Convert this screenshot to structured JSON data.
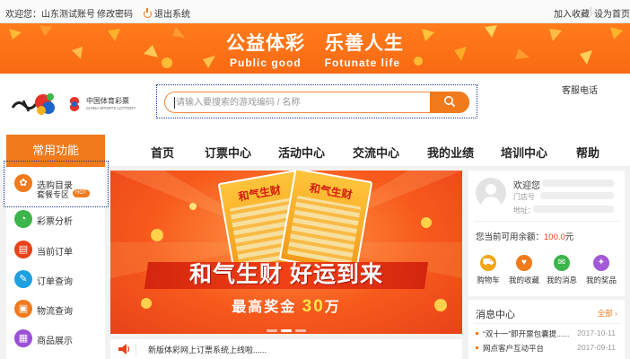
{
  "topbar": {
    "welcome": "欢迎您：山东测试账号",
    "change_password": "修改密码",
    "logout": "退出系统",
    "favorite": "加入收藏",
    "set_homepage": "设为首页"
  },
  "banner": {
    "title": "公益体彩　乐善人生",
    "subtitle": "Public good　　Fotunate life"
  },
  "header": {
    "lottery_name": "中国体育彩票",
    "lottery_name_en": "CHINA SPORTS LOTTERY",
    "search_placeholder": "请输入要搜索的游戏编码 / 名称",
    "hotline_label": "客服电话"
  },
  "nav": {
    "items": [
      "首页",
      "订票中心",
      "活动中心",
      "交流中心",
      "我的业绩",
      "培训中心",
      "帮助"
    ]
  },
  "sidebar": {
    "title": "常用功能",
    "items": [
      {
        "label": "选购目录",
        "icon": "catalog-icon",
        "color": "#f07a1c"
      },
      {
        "label": "彩票分析",
        "icon": "analysis-icon",
        "color": "#3cb54a"
      },
      {
        "label": "当前订单",
        "icon": "order-icon",
        "color": "#e8421a"
      },
      {
        "label": "订单查询",
        "icon": "order-search-icon",
        "color": "#1ea0e0"
      },
      {
        "label": "物流查询",
        "icon": "logistics-icon",
        "color": "#f07a1c"
      },
      {
        "label": "商品展示",
        "icon": "product-icon",
        "color": "#9b4fd6"
      }
    ],
    "sub_item": "套餐专区",
    "hot_badge": "HOT"
  },
  "promo": {
    "card_title": "和气生财",
    "headline": "和气生财 好运到来",
    "prize_prefix": "最高奖金",
    "prize_amount": "30",
    "prize_suffix": "万",
    "slide_index": 2,
    "slide_count": 3
  },
  "notice": {
    "text": "新版体彩网上订票系统上线啦......"
  },
  "user": {
    "welcome": "欢迎您",
    "store_label": "门店号",
    "address_label": "地址：",
    "balance_label": "您当前可用余额：",
    "balance_amount": "100.0",
    "balance_unit": "元",
    "actions": [
      {
        "label": "购物车",
        "icon": "cart-icon",
        "color": "#f2a516"
      },
      {
        "label": "我的收藏",
        "icon": "heart-icon",
        "color": "#f07a1c"
      },
      {
        "label": "我的消息",
        "icon": "message-icon",
        "color": "#3cb54a"
      },
      {
        "label": "我的奖品",
        "icon": "gift-icon",
        "color": "#a45ad8"
      }
    ]
  },
  "messages": {
    "title": "消息中心",
    "more": "全部 ›",
    "items": [
      {
        "text": "“双十一”即开票包囊提......",
        "date": "2017-10-11"
      },
      {
        "text": "网点客户互动平台",
        "date": "2017-09-11"
      }
    ]
  },
  "colors": {
    "accent": "#f07a1c",
    "banner": "#f96a12",
    "focus_outline": "#1a3c9e"
  }
}
